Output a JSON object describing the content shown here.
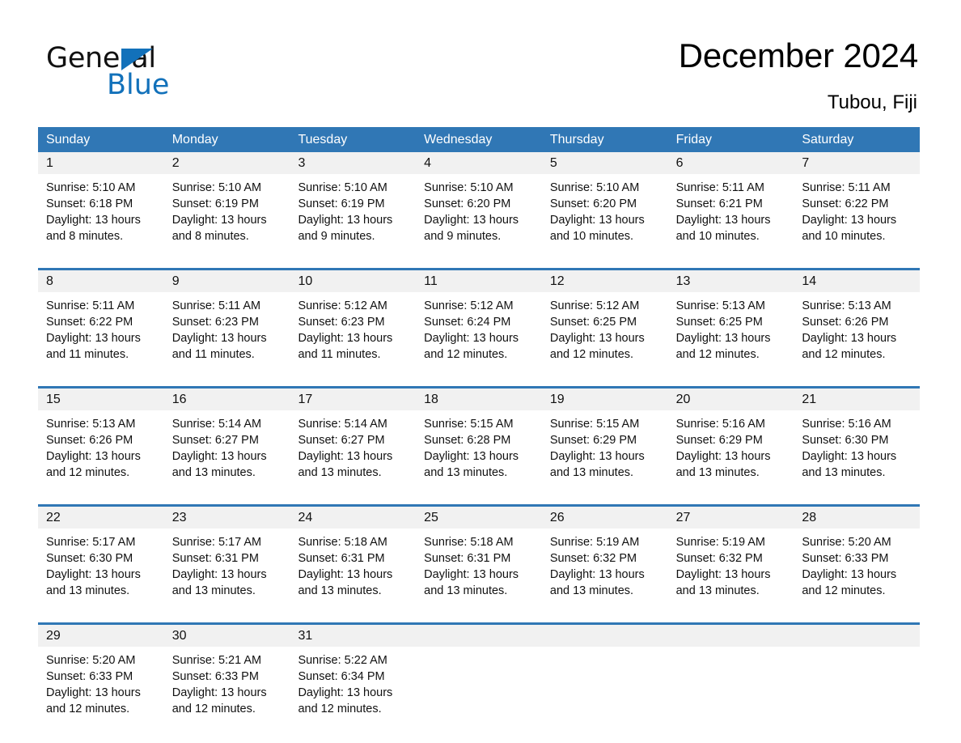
{
  "brand": {
    "name_part1": "General",
    "name_part2": "Blue",
    "triangle_color": "#1271BA"
  },
  "header": {
    "title": "December 2024",
    "location": "Tubou, Fiji"
  },
  "theme": {
    "header_blue": "#3077B5",
    "row_divider_blue": "#3077B5",
    "daynum_band": "#F1F1F1",
    "text": "#111111"
  },
  "calendar": {
    "weekdays": [
      "Sunday",
      "Monday",
      "Tuesday",
      "Wednesday",
      "Thursday",
      "Friday",
      "Saturday"
    ],
    "weeks": [
      [
        {
          "day": "1",
          "sunrise": "Sunrise: 5:10 AM",
          "sunset": "Sunset: 6:18 PM",
          "daylight_line1": "Daylight: 13 hours",
          "daylight_line2": "and 8 minutes."
        },
        {
          "day": "2",
          "sunrise": "Sunrise: 5:10 AM",
          "sunset": "Sunset: 6:19 PM",
          "daylight_line1": "Daylight: 13 hours",
          "daylight_line2": "and 8 minutes."
        },
        {
          "day": "3",
          "sunrise": "Sunrise: 5:10 AM",
          "sunset": "Sunset: 6:19 PM",
          "daylight_line1": "Daylight: 13 hours",
          "daylight_line2": "and 9 minutes."
        },
        {
          "day": "4",
          "sunrise": "Sunrise: 5:10 AM",
          "sunset": "Sunset: 6:20 PM",
          "daylight_line1": "Daylight: 13 hours",
          "daylight_line2": "and 9 minutes."
        },
        {
          "day": "5",
          "sunrise": "Sunrise: 5:10 AM",
          "sunset": "Sunset: 6:20 PM",
          "daylight_line1": "Daylight: 13 hours",
          "daylight_line2": "and 10 minutes."
        },
        {
          "day": "6",
          "sunrise": "Sunrise: 5:11 AM",
          "sunset": "Sunset: 6:21 PM",
          "daylight_line1": "Daylight: 13 hours",
          "daylight_line2": "and 10 minutes."
        },
        {
          "day": "7",
          "sunrise": "Sunrise: 5:11 AM",
          "sunset": "Sunset: 6:22 PM",
          "daylight_line1": "Daylight: 13 hours",
          "daylight_line2": "and 10 minutes."
        }
      ],
      [
        {
          "day": "8",
          "sunrise": "Sunrise: 5:11 AM",
          "sunset": "Sunset: 6:22 PM",
          "daylight_line1": "Daylight: 13 hours",
          "daylight_line2": "and 11 minutes."
        },
        {
          "day": "9",
          "sunrise": "Sunrise: 5:11 AM",
          "sunset": "Sunset: 6:23 PM",
          "daylight_line1": "Daylight: 13 hours",
          "daylight_line2": "and 11 minutes."
        },
        {
          "day": "10",
          "sunrise": "Sunrise: 5:12 AM",
          "sunset": "Sunset: 6:23 PM",
          "daylight_line1": "Daylight: 13 hours",
          "daylight_line2": "and 11 minutes."
        },
        {
          "day": "11",
          "sunrise": "Sunrise: 5:12 AM",
          "sunset": "Sunset: 6:24 PM",
          "daylight_line1": "Daylight: 13 hours",
          "daylight_line2": "and 12 minutes."
        },
        {
          "day": "12",
          "sunrise": "Sunrise: 5:12 AM",
          "sunset": "Sunset: 6:25 PM",
          "daylight_line1": "Daylight: 13 hours",
          "daylight_line2": "and 12 minutes."
        },
        {
          "day": "13",
          "sunrise": "Sunrise: 5:13 AM",
          "sunset": "Sunset: 6:25 PM",
          "daylight_line1": "Daylight: 13 hours",
          "daylight_line2": "and 12 minutes."
        },
        {
          "day": "14",
          "sunrise": "Sunrise: 5:13 AM",
          "sunset": "Sunset: 6:26 PM",
          "daylight_line1": "Daylight: 13 hours",
          "daylight_line2": "and 12 minutes."
        }
      ],
      [
        {
          "day": "15",
          "sunrise": "Sunrise: 5:13 AM",
          "sunset": "Sunset: 6:26 PM",
          "daylight_line1": "Daylight: 13 hours",
          "daylight_line2": "and 12 minutes."
        },
        {
          "day": "16",
          "sunrise": "Sunrise: 5:14 AM",
          "sunset": "Sunset: 6:27 PM",
          "daylight_line1": "Daylight: 13 hours",
          "daylight_line2": "and 13 minutes."
        },
        {
          "day": "17",
          "sunrise": "Sunrise: 5:14 AM",
          "sunset": "Sunset: 6:27 PM",
          "daylight_line1": "Daylight: 13 hours",
          "daylight_line2": "and 13 minutes."
        },
        {
          "day": "18",
          "sunrise": "Sunrise: 5:15 AM",
          "sunset": "Sunset: 6:28 PM",
          "daylight_line1": "Daylight: 13 hours",
          "daylight_line2": "and 13 minutes."
        },
        {
          "day": "19",
          "sunrise": "Sunrise: 5:15 AM",
          "sunset": "Sunset: 6:29 PM",
          "daylight_line1": "Daylight: 13 hours",
          "daylight_line2": "and 13 minutes."
        },
        {
          "day": "20",
          "sunrise": "Sunrise: 5:16 AM",
          "sunset": "Sunset: 6:29 PM",
          "daylight_line1": "Daylight: 13 hours",
          "daylight_line2": "and 13 minutes."
        },
        {
          "day": "21",
          "sunrise": "Sunrise: 5:16 AM",
          "sunset": "Sunset: 6:30 PM",
          "daylight_line1": "Daylight: 13 hours",
          "daylight_line2": "and 13 minutes."
        }
      ],
      [
        {
          "day": "22",
          "sunrise": "Sunrise: 5:17 AM",
          "sunset": "Sunset: 6:30 PM",
          "daylight_line1": "Daylight: 13 hours",
          "daylight_line2": "and 13 minutes."
        },
        {
          "day": "23",
          "sunrise": "Sunrise: 5:17 AM",
          "sunset": "Sunset: 6:31 PM",
          "daylight_line1": "Daylight: 13 hours",
          "daylight_line2": "and 13 minutes."
        },
        {
          "day": "24",
          "sunrise": "Sunrise: 5:18 AM",
          "sunset": "Sunset: 6:31 PM",
          "daylight_line1": "Daylight: 13 hours",
          "daylight_line2": "and 13 minutes."
        },
        {
          "day": "25",
          "sunrise": "Sunrise: 5:18 AM",
          "sunset": "Sunset: 6:31 PM",
          "daylight_line1": "Daylight: 13 hours",
          "daylight_line2": "and 13 minutes."
        },
        {
          "day": "26",
          "sunrise": "Sunrise: 5:19 AM",
          "sunset": "Sunset: 6:32 PM",
          "daylight_line1": "Daylight: 13 hours",
          "daylight_line2": "and 13 minutes."
        },
        {
          "day": "27",
          "sunrise": "Sunrise: 5:19 AM",
          "sunset": "Sunset: 6:32 PM",
          "daylight_line1": "Daylight: 13 hours",
          "daylight_line2": "and 13 minutes."
        },
        {
          "day": "28",
          "sunrise": "Sunrise: 5:20 AM",
          "sunset": "Sunset: 6:33 PM",
          "daylight_line1": "Daylight: 13 hours",
          "daylight_line2": "and 12 minutes."
        }
      ],
      [
        {
          "day": "29",
          "sunrise": "Sunrise: 5:20 AM",
          "sunset": "Sunset: 6:33 PM",
          "daylight_line1": "Daylight: 13 hours",
          "daylight_line2": "and 12 minutes."
        },
        {
          "day": "30",
          "sunrise": "Sunrise: 5:21 AM",
          "sunset": "Sunset: 6:33 PM",
          "daylight_line1": "Daylight: 13 hours",
          "daylight_line2": "and 12 minutes."
        },
        {
          "day": "31",
          "sunrise": "Sunrise: 5:22 AM",
          "sunset": "Sunset: 6:34 PM",
          "daylight_line1": "Daylight: 13 hours",
          "daylight_line2": "and 12 minutes."
        },
        {
          "day": "",
          "sunrise": "",
          "sunset": "",
          "daylight_line1": "",
          "daylight_line2": ""
        },
        {
          "day": "",
          "sunrise": "",
          "sunset": "",
          "daylight_line1": "",
          "daylight_line2": ""
        },
        {
          "day": "",
          "sunrise": "",
          "sunset": "",
          "daylight_line1": "",
          "daylight_line2": ""
        },
        {
          "day": "",
          "sunrise": "",
          "sunset": "",
          "daylight_line1": "",
          "daylight_line2": ""
        }
      ]
    ]
  }
}
